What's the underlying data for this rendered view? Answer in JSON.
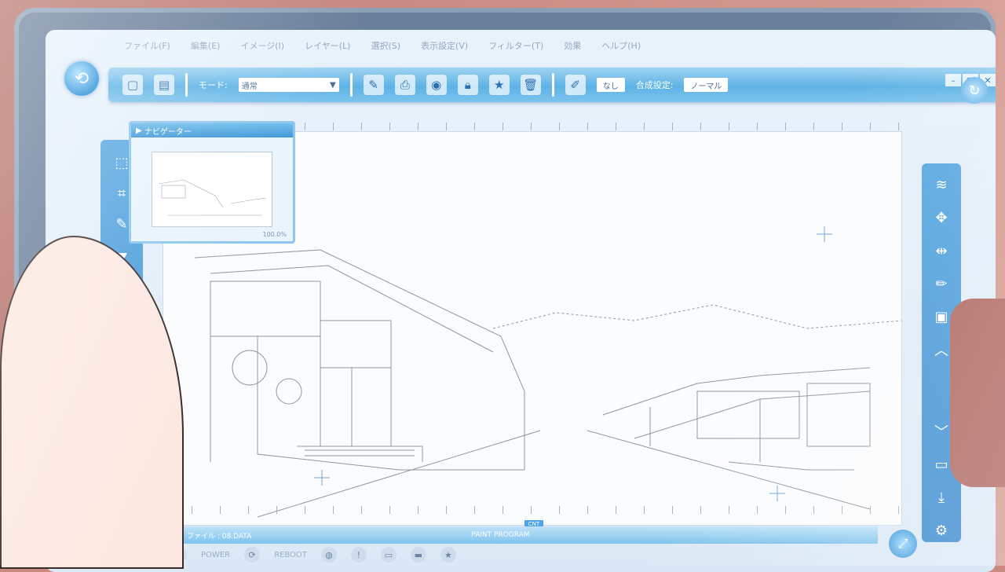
{
  "menu": {
    "items": [
      "ファイル(F)",
      "編集(E)",
      "イメージ(I)",
      "レイヤー(L)",
      "選択(S)",
      "表示設定(V)",
      "フィルター(T)",
      "効果",
      "ヘルプ(H)"
    ]
  },
  "toolbar": {
    "mode_label": "モード:",
    "mode_value": "通常",
    "field_value": "なし",
    "blend_label": "合成設定:",
    "blend_value": "ノーマル"
  },
  "navigator": {
    "title": "ナビゲーター",
    "zoom": "100.0%"
  },
  "statusbar": {
    "file_label": "ファイル : 08.DATA",
    "app_name": "PAINT PROGRAM"
  },
  "bottombar": {
    "power_label": "POWER",
    "reboot_label": "REBOOT"
  },
  "canvas": {
    "center_marker": "CNT"
  },
  "colors": {
    "accent": "#4ea6e6",
    "toolbar": "#5eb3e6"
  }
}
